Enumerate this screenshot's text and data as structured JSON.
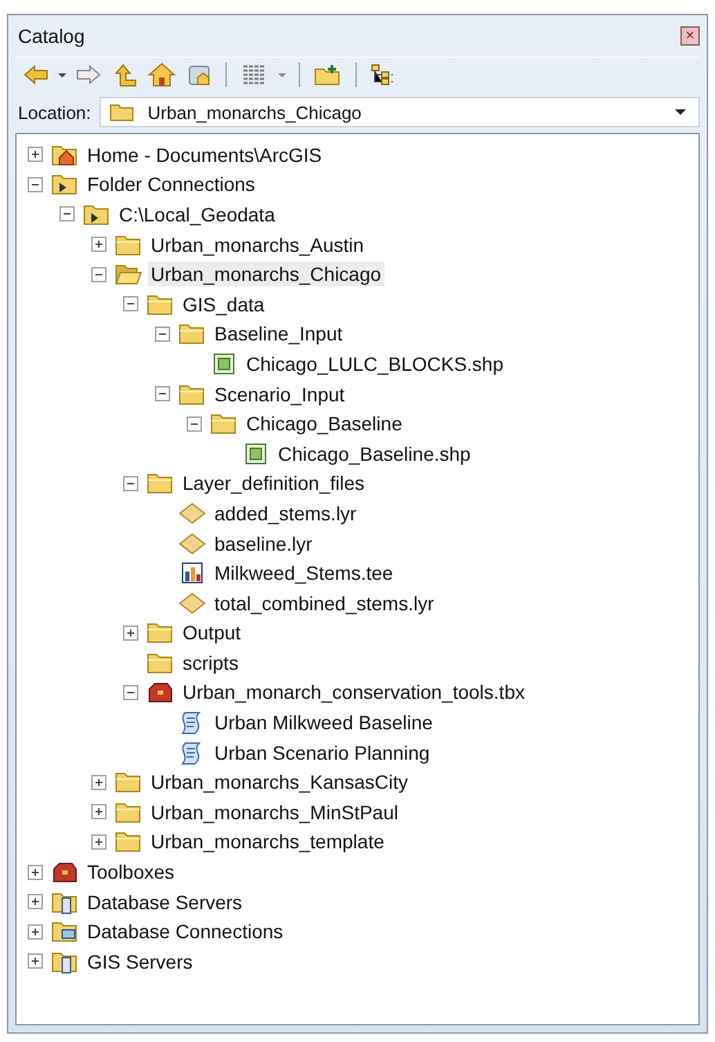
{
  "window": {
    "title": "Catalog",
    "close": "×"
  },
  "location": {
    "label": "Location:",
    "value": "Urban_monarchs_Chicago"
  },
  "tree": [
    {
      "label": "Home - Documents\\ArcGIS",
      "kind": "home",
      "expanded": false,
      "selected": false
    },
    {
      "label": "Folder Connections",
      "kind": "connections",
      "expanded": true,
      "selected": false,
      "children": [
        {
          "label": "C:\\Local_Geodata",
          "kind": "connection",
          "expanded": true,
          "selected": false,
          "children": [
            {
              "label": "Urban_monarchs_Austin",
              "kind": "folder",
              "expanded": false,
              "selected": false
            },
            {
              "label": "Urban_monarchs_Chicago",
              "kind": "folder-open",
              "expanded": true,
              "selected": true,
              "children": [
                {
                  "label": "GIS_data",
                  "kind": "folder",
                  "expanded": true,
                  "selected": false,
                  "children": [
                    {
                      "label": "Baseline_Input",
                      "kind": "folder",
                      "expanded": true,
                      "selected": false,
                      "children": [
                        {
                          "label": "Chicago_LULC_BLOCKS.shp",
                          "kind": "shapefile",
                          "selected": false
                        }
                      ]
                    },
                    {
                      "label": "Scenario_Input",
                      "kind": "folder",
                      "expanded": true,
                      "selected": false,
                      "children": [
                        {
                          "label": "Chicago_Baseline",
                          "kind": "folder",
                          "expanded": true,
                          "selected": false,
                          "children": [
                            {
                              "label": "Chicago_Baseline.shp",
                              "kind": "shapefile",
                              "selected": false
                            }
                          ]
                        }
                      ]
                    }
                  ]
                },
                {
                  "label": "Layer_definition_files",
                  "kind": "folder",
                  "expanded": true,
                  "selected": false,
                  "children": [
                    {
                      "label": "added_stems.lyr",
                      "kind": "layer",
                      "selected": false
                    },
                    {
                      "label": "baseline.lyr",
                      "kind": "layer",
                      "selected": false
                    },
                    {
                      "label": "Milkweed_Stems.tee",
                      "kind": "graph",
                      "selected": false
                    },
                    {
                      "label": "total_combined_stems.lyr",
                      "kind": "layer",
                      "selected": false
                    }
                  ]
                },
                {
                  "label": "Output",
                  "kind": "folder",
                  "expanded": false,
                  "selected": false
                },
                {
                  "label": "scripts",
                  "kind": "folder",
                  "selected": false
                },
                {
                  "label": "Urban_monarch_conservation_tools.tbx",
                  "kind": "toolbox",
                  "expanded": true,
                  "selected": false,
                  "children": [
                    {
                      "label": "Urban Milkweed Baseline",
                      "kind": "script",
                      "selected": false
                    },
                    {
                      "label": "Urban Scenario Planning",
                      "kind": "script",
                      "selected": false
                    }
                  ]
                }
              ]
            },
            {
              "label": "Urban_monarchs_KansasCity",
              "kind": "folder",
              "expanded": false,
              "selected": false
            },
            {
              "label": "Urban_monarchs_MinStPaul",
              "kind": "folder",
              "expanded": false,
              "selected": false
            },
            {
              "label": "Urban_monarchs_template",
              "kind": "folder",
              "expanded": false,
              "selected": false
            }
          ]
        }
      ]
    },
    {
      "label": "Toolboxes",
      "kind": "toolboxes",
      "expanded": false,
      "selected": false
    },
    {
      "label": "Database Servers",
      "kind": "db-servers",
      "expanded": false,
      "selected": false
    },
    {
      "label": "Database Connections",
      "kind": "db-connections",
      "expanded": false,
      "selected": false
    },
    {
      "label": "GIS Servers",
      "kind": "gis-servers",
      "expanded": false,
      "selected": false
    }
  ]
}
